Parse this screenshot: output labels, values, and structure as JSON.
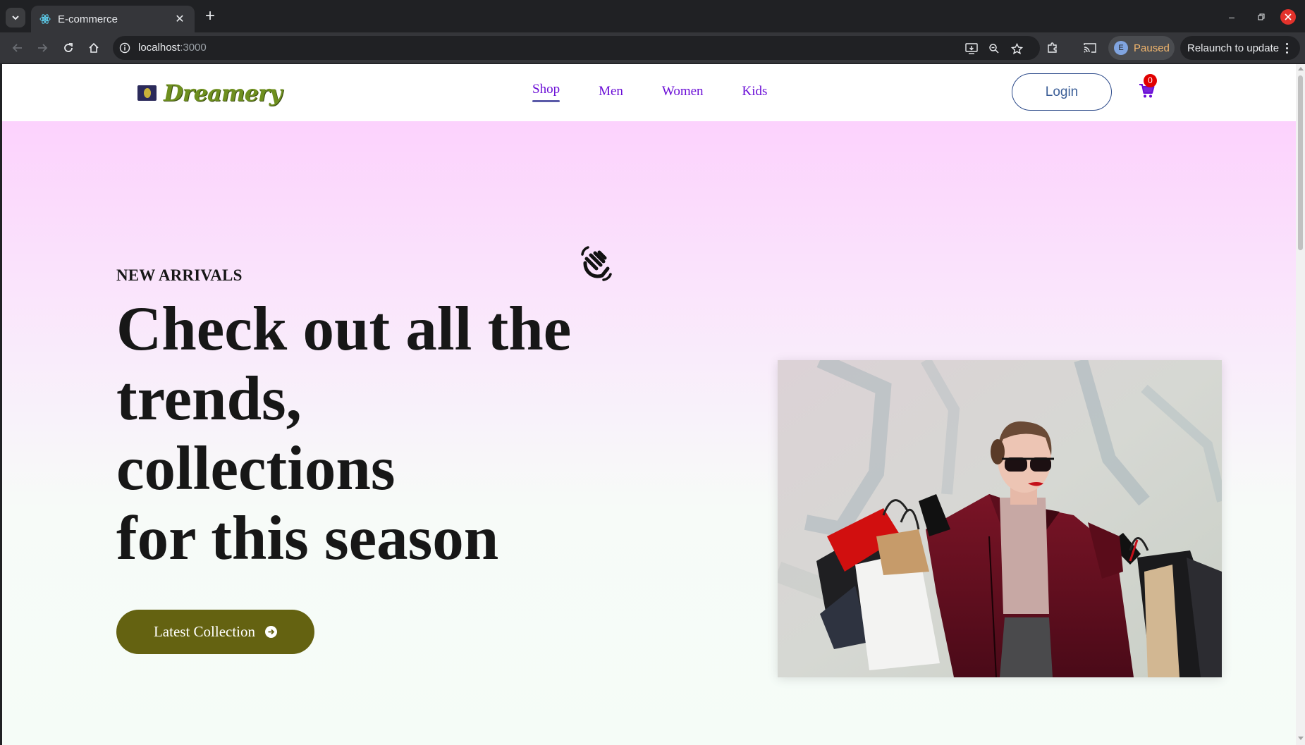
{
  "browser": {
    "tab": {
      "title": "E-commerce"
    },
    "url": {
      "host": "localhost",
      "port": ":3000"
    },
    "profile": {
      "initial": "E",
      "status": "Paused"
    },
    "relaunch_label": "Relaunch to update"
  },
  "site": {
    "brand": "Dreamery",
    "nav": [
      "Shop",
      "Men",
      "Women",
      "Kids"
    ],
    "active_nav": "Shop",
    "login_label": "Login",
    "cart_count": "0",
    "accent_color": "#6a0dd6"
  },
  "hero": {
    "eyebrow": "NEW ARRIVALS",
    "headline_lines": [
      "Check out all the",
      "trends,",
      "collections",
      "for this season"
    ],
    "cta_label": "Latest Collection",
    "cta_color": "#646211",
    "gradient_top": "#fcd2fd",
    "gradient_bottom": "#f5fcf7",
    "image_alt": "Woman in red coat and sunglasses holding shopping bags"
  }
}
